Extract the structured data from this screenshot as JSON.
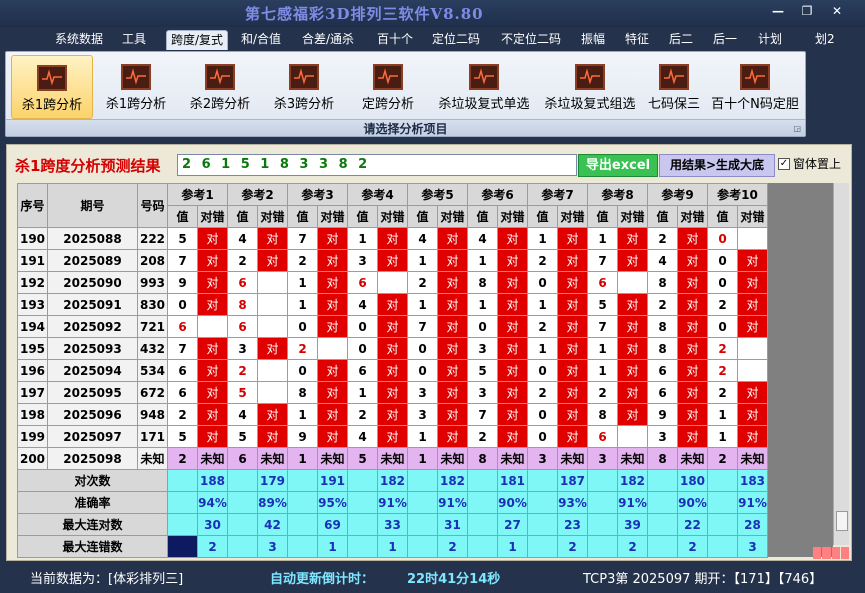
{
  "app": {
    "title": "第七感福彩3D排列三软件V8.80",
    "restore_glyph": "❐",
    "close_glyph": "✕"
  },
  "menu": [
    "系统数据",
    "工具",
    "跨度/复式",
    "和/合值",
    "合差/通杀",
    "百十个",
    "定位二码",
    "不定位二码",
    "振幅",
    "特征",
    "后二",
    "后一",
    "计划",
    "划2"
  ],
  "menu_active": 2,
  "ribbon": {
    "buttons": [
      "杀1跨分析",
      "杀1跨分析",
      "杀2跨分析",
      "杀3跨分析",
      "定跨分析",
      "杀垃圾复式单选",
      "杀垃圾复式组选",
      "七码保三",
      "百十个N码定胆"
    ],
    "selected": 0,
    "footer": "请选择分析项目",
    "icon_name": "chart-icon",
    "expand_glyph": "◲"
  },
  "result": {
    "label": "杀1跨度分析预测结果",
    "value": "2 6 1 5 1 8 3 3 8 2",
    "export_btn": "导出excel",
    "apply_btn": "用结果>生成大底",
    "ontop_label": "窗体置上",
    "ontop_checked": "✓"
  },
  "grid": {
    "head_fixed": [
      "序号",
      "期号",
      "号码"
    ],
    "refs": [
      "参考1",
      "参考2",
      "参考3",
      "参考4",
      "参考5",
      "参考6",
      "参考7",
      "参考8",
      "参考9",
      "参考10"
    ],
    "sub": [
      "值",
      "对错"
    ],
    "hit_text": "对",
    "unknown_text": "未知",
    "rows": [
      {
        "seq": "190",
        "issue": "2025088",
        "num": "222",
        "vals": [
          "5",
          "4",
          "7",
          "1",
          "4",
          "4",
          "1",
          "1",
          "2",
          "0"
        ],
        "hits": [
          1,
          1,
          1,
          1,
          1,
          1,
          1,
          1,
          1,
          0
        ],
        "red": [
          0,
          0,
          0,
          0,
          0,
          0,
          0,
          0,
          0,
          1
        ]
      },
      {
        "seq": "191",
        "issue": "2025089",
        "num": "208",
        "vals": [
          "7",
          "2",
          "2",
          "3",
          "1",
          "1",
          "2",
          "7",
          "4",
          "0"
        ],
        "hits": [
          1,
          1,
          1,
          1,
          1,
          1,
          1,
          1,
          1,
          1
        ],
        "red": [
          0,
          0,
          0,
          0,
          0,
          0,
          0,
          0,
          0,
          0
        ]
      },
      {
        "seq": "192",
        "issue": "2025090",
        "num": "993",
        "vals": [
          "9",
          "6",
          "1",
          "6",
          "2",
          "8",
          "0",
          "6",
          "8",
          "0"
        ],
        "hits": [
          1,
          0,
          1,
          0,
          1,
          1,
          1,
          0,
          1,
          1
        ],
        "red": [
          0,
          1,
          0,
          1,
          0,
          0,
          0,
          1,
          0,
          0
        ]
      },
      {
        "seq": "193",
        "issue": "2025091",
        "num": "830",
        "vals": [
          "0",
          "8",
          "1",
          "4",
          "1",
          "1",
          "1",
          "5",
          "2",
          "2"
        ],
        "hits": [
          1,
          0,
          1,
          1,
          1,
          1,
          1,
          1,
          1,
          1
        ],
        "red": [
          0,
          1,
          0,
          0,
          0,
          0,
          0,
          0,
          0,
          0
        ]
      },
      {
        "seq": "194",
        "issue": "2025092",
        "num": "721",
        "vals": [
          "6",
          "6",
          "0",
          "0",
          "7",
          "0",
          "2",
          "7",
          "8",
          "0"
        ],
        "hits": [
          0,
          0,
          1,
          1,
          1,
          1,
          1,
          1,
          1,
          1
        ],
        "red": [
          1,
          1,
          0,
          0,
          0,
          0,
          0,
          0,
          0,
          0
        ]
      },
      {
        "seq": "195",
        "issue": "2025093",
        "num": "432",
        "vals": [
          "7",
          "3",
          "2",
          "0",
          "0",
          "3",
          "1",
          "1",
          "8",
          "2"
        ],
        "hits": [
          1,
          1,
          0,
          1,
          1,
          1,
          1,
          1,
          1,
          0
        ],
        "red": [
          0,
          0,
          1,
          0,
          0,
          0,
          0,
          0,
          0,
          1
        ]
      },
      {
        "seq": "196",
        "issue": "2025094",
        "num": "534",
        "vals": [
          "6",
          "2",
          "0",
          "6",
          "0",
          "5",
          "0",
          "1",
          "6",
          "2"
        ],
        "hits": [
          1,
          0,
          1,
          1,
          1,
          1,
          1,
          1,
          1,
          0
        ],
        "red": [
          0,
          1,
          0,
          0,
          0,
          0,
          0,
          0,
          0,
          1
        ]
      },
      {
        "seq": "197",
        "issue": "2025095",
        "num": "672",
        "vals": [
          "6",
          "5",
          "8",
          "1",
          "3",
          "3",
          "2",
          "2",
          "6",
          "2"
        ],
        "hits": [
          1,
          0,
          1,
          1,
          1,
          1,
          1,
          1,
          1,
          1
        ],
        "red": [
          0,
          1,
          0,
          0,
          0,
          0,
          0,
          0,
          0,
          0
        ]
      },
      {
        "seq": "198",
        "issue": "2025096",
        "num": "948",
        "vals": [
          "2",
          "4",
          "1",
          "2",
          "3",
          "7",
          "0",
          "8",
          "9",
          "1"
        ],
        "hits": [
          1,
          1,
          1,
          1,
          1,
          1,
          1,
          1,
          1,
          1
        ],
        "red": [
          0,
          0,
          0,
          0,
          0,
          0,
          0,
          0,
          0,
          0
        ]
      },
      {
        "seq": "199",
        "issue": "2025097",
        "num": "171",
        "vals": [
          "5",
          "5",
          "9",
          "4",
          "1",
          "2",
          "0",
          "6",
          "3",
          "1"
        ],
        "hits": [
          1,
          1,
          1,
          1,
          1,
          1,
          1,
          0,
          1,
          1
        ],
        "red": [
          0,
          0,
          0,
          0,
          0,
          0,
          0,
          1,
          0,
          0
        ]
      }
    ],
    "unknown_row": {
      "seq": "200",
      "issue": "2025098",
      "num": "未知",
      "vals": [
        "2",
        "6",
        "1",
        "5",
        "1",
        "8",
        "3",
        "3",
        "8",
        "2"
      ]
    },
    "stats": [
      {
        "label": "对次数",
        "vals": [
          "188",
          "179",
          "191",
          "182",
          "182",
          "181",
          "187",
          "182",
          "180",
          "183"
        ]
      },
      {
        "label": "准确率",
        "vals": [
          "94%",
          "89%",
          "95%",
          "91%",
          "91%",
          "90%",
          "93%",
          "91%",
          "90%",
          "91%"
        ]
      },
      {
        "label": "最大连对数",
        "vals": [
          "30",
          "42",
          "69",
          "33",
          "31",
          "27",
          "23",
          "39",
          "22",
          "28"
        ]
      },
      {
        "label": "最大连错数",
        "vals": [
          "2",
          "3",
          "1",
          "1",
          "2",
          "1",
          "2",
          "2",
          "2",
          "3"
        ]
      }
    ]
  },
  "status": {
    "current": "当前数据为：[体彩排列三]",
    "countdown_label": "自动更新倒计时：",
    "countdown": "22时41分14秒",
    "tcp": "TCP3第 2025097 期开：【171】【746】"
  },
  "colors": {
    "hit": "#e00000",
    "stat": "#7ff7f7",
    "unknown": "#e4b4f0",
    "accent": "#7e8ce6"
  }
}
